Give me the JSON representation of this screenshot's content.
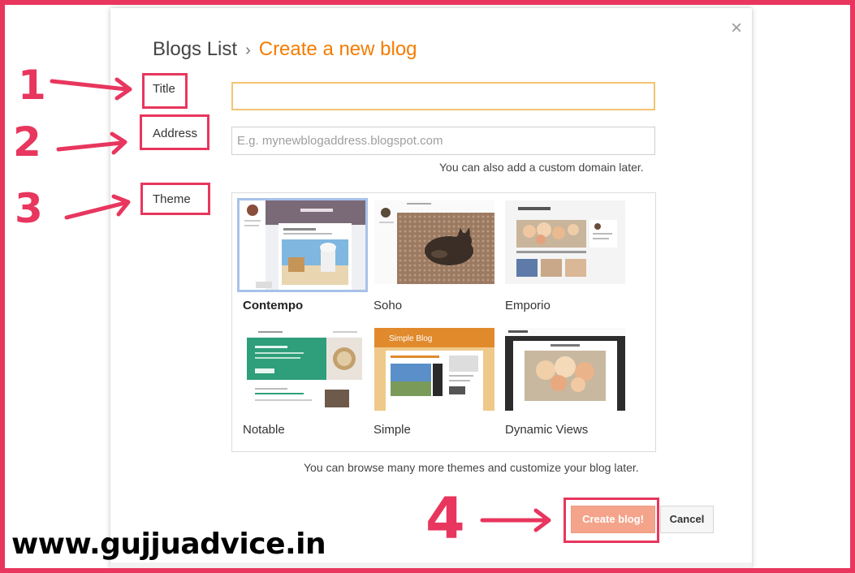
{
  "breadcrumb": {
    "root": "Blogs List",
    "separator": "›",
    "current": "Create a new blog"
  },
  "close_icon": "×",
  "fields": {
    "title_label": "Title",
    "title_value": "",
    "address_label": "Address",
    "address_placeholder": "E.g. mynewblogaddress.blogspot.com",
    "address_hint": "You can also add a custom domain later.",
    "theme_label": "Theme"
  },
  "themes": [
    {
      "name": "Contempo",
      "selected": true
    },
    {
      "name": "Soho",
      "selected": false
    },
    {
      "name": "Emporio",
      "selected": false
    },
    {
      "name": "Notable",
      "selected": false
    },
    {
      "name": "Simple",
      "selected": false
    },
    {
      "name": "Dynamic Views",
      "selected": false
    }
  ],
  "themes_hint": "You can browse many more themes and customize your blog later.",
  "actions": {
    "create_label": "Create blog!",
    "cancel_label": "Cancel"
  },
  "annotations": [
    "1",
    "2",
    "3",
    "4"
  ],
  "watermark": "www.gujjuadvice.in",
  "colors": {
    "accent_orange": "#f57c00",
    "annotation_red": "#e8365e",
    "create_button": "#f4a48b",
    "selected_outline": "#a9c1ea"
  }
}
